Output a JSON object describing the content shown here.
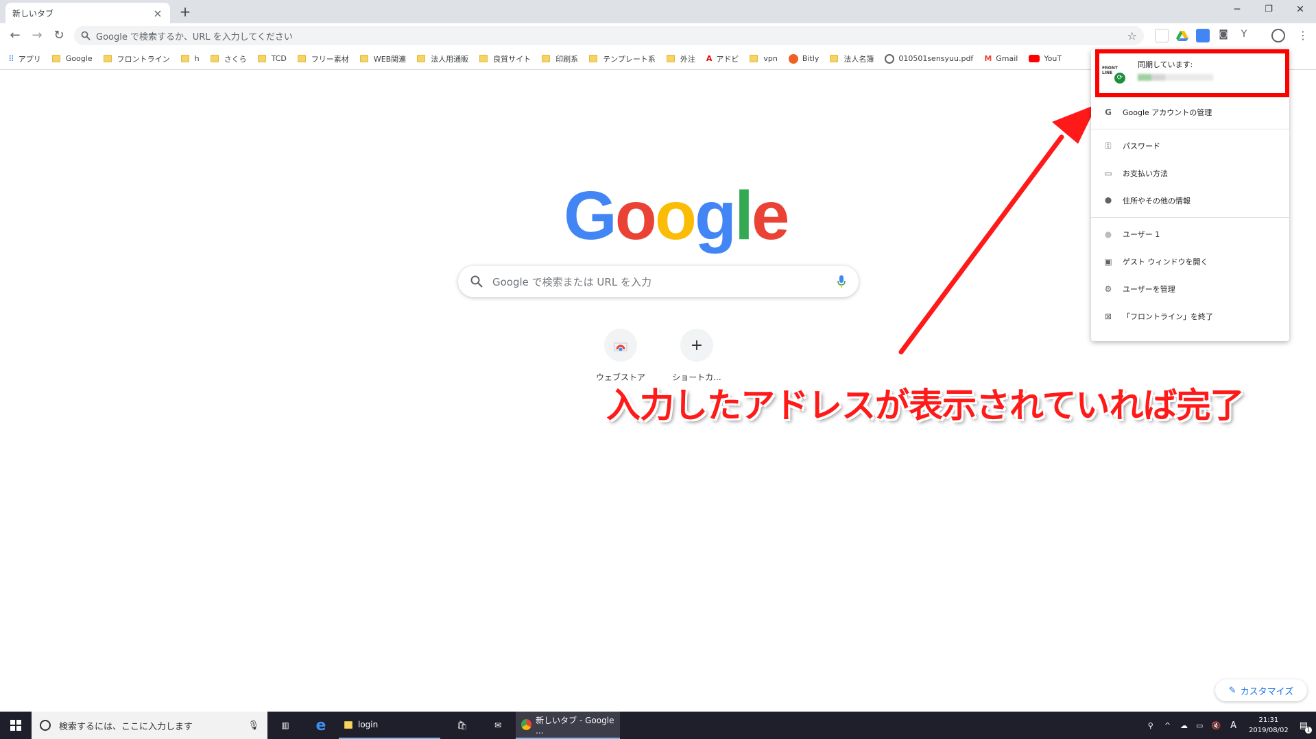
{
  "tab": {
    "title": "新しいタブ",
    "close": "×",
    "new_tab": "+"
  },
  "window": {
    "minimize": "─",
    "restore": "❐",
    "close": "✕"
  },
  "omnibox": {
    "placeholder": "Google で検索するか、URL を入力してください"
  },
  "bookmarks": [
    {
      "label": "アプリ",
      "icon": "apps-icon"
    },
    {
      "label": "Google",
      "icon": "folder-icon"
    },
    {
      "label": "フロントライン",
      "icon": "folder-icon"
    },
    {
      "label": "h",
      "icon": "folder-icon"
    },
    {
      "label": "さくら",
      "icon": "folder-icon"
    },
    {
      "label": "TCD",
      "icon": "folder-icon"
    },
    {
      "label": "フリー素材",
      "icon": "folder-icon"
    },
    {
      "label": "WEB関連",
      "icon": "folder-icon"
    },
    {
      "label": "法人用通販",
      "icon": "folder-icon"
    },
    {
      "label": "良質サイト",
      "icon": "folder-icon"
    },
    {
      "label": "印刷系",
      "icon": "folder-icon"
    },
    {
      "label": "テンプレート系",
      "icon": "folder-icon"
    },
    {
      "label": "外注",
      "icon": "folder-icon"
    },
    {
      "label": "アドビ",
      "icon": "adobe-icon"
    },
    {
      "label": "vpn",
      "icon": "folder-icon"
    },
    {
      "label": "Bitly",
      "icon": "bitly-icon"
    },
    {
      "label": "法人名簿",
      "icon": "folder-icon"
    },
    {
      "label": "010501sensyuu.pdf",
      "icon": "globe-icon"
    },
    {
      "label": "Gmail",
      "icon": "gmail-icon"
    },
    {
      "label": "YouT",
      "icon": "youtube-icon"
    }
  ],
  "logo": {
    "g1": "G",
    "o1": "o",
    "o2": "o",
    "g2": "g",
    "l": "l",
    "e": "e"
  },
  "search": {
    "placeholder": "Google で検索または URL を入力"
  },
  "shortcuts": [
    {
      "label": "ウェブストア",
      "icon": "webstore-icon"
    },
    {
      "label": "ショートカ...",
      "icon": "plus-icon",
      "glyph": "+"
    }
  ],
  "annotation": "入力したアドレスが表示されていれば完了",
  "profile_menu": {
    "sync_logo": "FRONT LINE",
    "sync_label": "同期しています:",
    "items": [
      {
        "label": "Google アカウントの管理",
        "icon": "google-icon",
        "glyph": "G"
      },
      {
        "label": "パスワード",
        "icon": "key-icon",
        "glyph": "⚿"
      },
      {
        "label": "お支払い方法",
        "icon": "credit-card-icon",
        "glyph": "▭"
      },
      {
        "label": "住所やその他の情報",
        "icon": "location-pin-icon",
        "glyph": "⬤"
      },
      {
        "label": "ユーザー 1",
        "icon": "user-avatar-icon",
        "glyph": "●"
      },
      {
        "label": "ゲスト ウィンドウを開く",
        "icon": "guest-icon",
        "glyph": "▣"
      },
      {
        "label": "ユーザーを管理",
        "icon": "gear-icon",
        "glyph": "⚙"
      },
      {
        "label": "「フロントライン」を終了",
        "icon": "exit-icon",
        "glyph": "⊠"
      }
    ]
  },
  "customize": {
    "label": "カスタマイズ",
    "icon": "pencil-icon"
  },
  "taskbar": {
    "search_placeholder": "検索するには、ここに入力します",
    "login_label": "login",
    "chrome_label": "新しいタブ - Google ...",
    "time": "21:31",
    "date": "2019/08/02",
    "ime": "A",
    "notifications": "1"
  },
  "colors": {
    "google_blue": "#4285f4",
    "google_red": "#ea4335",
    "google_yellow": "#fbbc05",
    "google_green": "#34a853",
    "annotation_red": "#ff1a1a"
  }
}
